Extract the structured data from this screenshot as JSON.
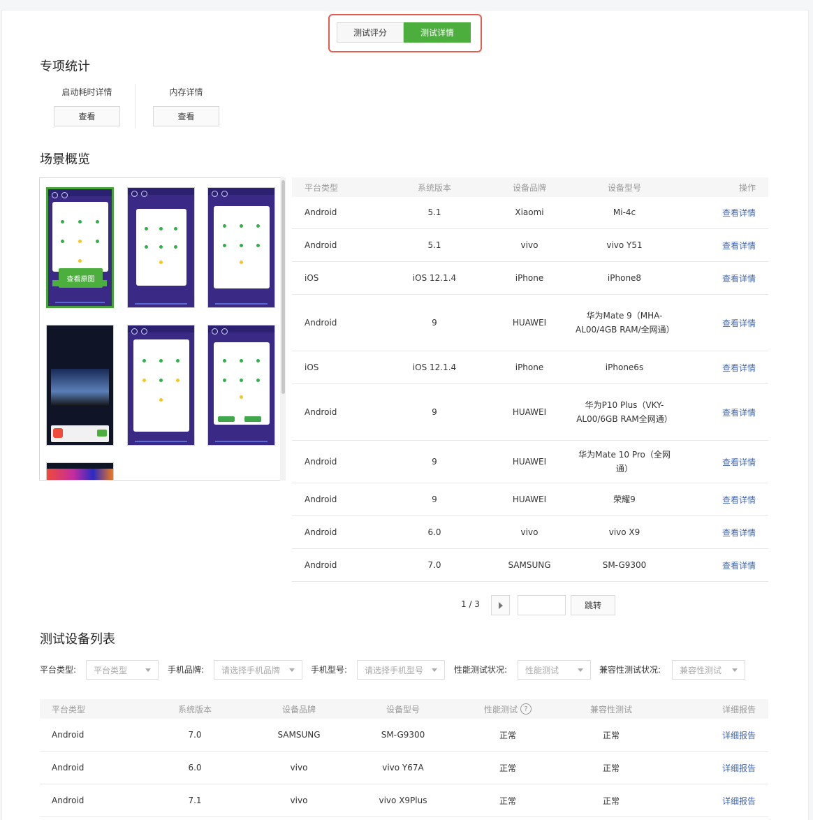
{
  "tabs": [
    {
      "label": "测试评分",
      "active": false
    },
    {
      "label": "测试详情",
      "active": true
    }
  ],
  "special_stats": {
    "title": "专项统计",
    "items": [
      {
        "label": "启动耗时详情",
        "button": "查看"
      },
      {
        "label": "内存详情",
        "button": "查看"
      }
    ]
  },
  "scene": {
    "title": "场景概览",
    "view_original_label": "查看原图",
    "table": {
      "headers": [
        "平台类型",
        "系统版本",
        "设备品牌",
        "设备型号",
        "操作"
      ],
      "action_label": "查看详情",
      "rows": [
        {
          "platform": "Android",
          "version": "5.1",
          "brand": "Xiaomi",
          "model": "Mi-4c"
        },
        {
          "platform": "Android",
          "version": "5.1",
          "brand": "vivo",
          "model": "vivo Y51"
        },
        {
          "platform": "iOS",
          "version": "iOS 12.1.4",
          "brand": "iPhone",
          "model": "iPhone8"
        },
        {
          "platform": "Android",
          "version": "9",
          "brand": "HUAWEI",
          "model": "华为Mate 9（MHA-AL00/4GB RAM/全网通）"
        },
        {
          "platform": "iOS",
          "version": "iOS 12.1.4",
          "brand": "iPhone",
          "model": "iPhone6s"
        },
        {
          "platform": "Android",
          "version": "9",
          "brand": "HUAWEI",
          "model": "华为P10 Plus（VKY-AL00/6GB RAM全网通）"
        },
        {
          "platform": "Android",
          "version": "9",
          "brand": "HUAWEI",
          "model": "华为Mate 10 Pro（全网通）"
        },
        {
          "platform": "Android",
          "version": "9",
          "brand": "HUAWEI",
          "model": "荣耀9"
        },
        {
          "platform": "Android",
          "version": "6.0",
          "brand": "vivo",
          "model": "vivo X9"
        },
        {
          "platform": "Android",
          "version": "7.0",
          "brand": "SAMSUNG",
          "model": "SM-G9300"
        }
      ]
    },
    "pager": {
      "text": "1 / 3",
      "jump_label": "跳转"
    }
  },
  "device_list": {
    "title": "测试设备列表",
    "filters": [
      {
        "label": "平台类型:",
        "placeholder": "平台类型"
      },
      {
        "label": "手机品牌:",
        "placeholder": "请选择手机品牌"
      },
      {
        "label": "手机型号:",
        "placeholder": "请选择手机型号"
      },
      {
        "label": "性能测试状况:",
        "placeholder": "性能测试"
      },
      {
        "label": "兼容性测试状况:",
        "placeholder": "兼容性测试"
      }
    ],
    "headers": [
      "平台类型",
      "系统版本",
      "设备品牌",
      "设备型号",
      "性能测试",
      "兼容性测试",
      "详细报告"
    ],
    "help_icon_glyph": "?",
    "report_label": "详细报告",
    "rows": [
      {
        "platform": "Android",
        "version": "7.0",
        "brand": "SAMSUNG",
        "model": "SM-G9300",
        "perf": "正常",
        "compat": "正常"
      },
      {
        "platform": "Android",
        "version": "6.0",
        "brand": "vivo",
        "model": "vivo Y67A",
        "perf": "正常",
        "compat": "正常"
      },
      {
        "platform": "Android",
        "version": "7.1",
        "brand": "vivo",
        "model": "vivo X9Plus",
        "perf": "正常",
        "compat": "正常"
      }
    ]
  },
  "colors": {
    "accent_green": "#4caf3d",
    "link_blue": "#4267b2",
    "highlight_red": "#e35c4f"
  }
}
